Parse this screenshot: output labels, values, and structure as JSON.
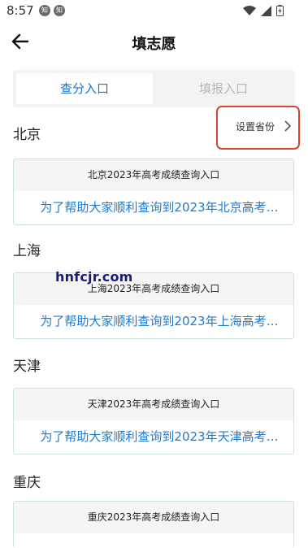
{
  "status_bar": {
    "time": "8:57",
    "notif_1": "知",
    "notif_2": "知"
  },
  "nav": {
    "title": "填志愿"
  },
  "tabs": [
    {
      "label": "查分入口"
    },
    {
      "label": "填报入口"
    }
  ],
  "set_province": {
    "label": "设置省份"
  },
  "provinces": [
    {
      "name": "北京",
      "card_title": "北京2023年高考成绩查询入口",
      "card_link": "为了帮助大家顺利查询到2023年北京高考…"
    },
    {
      "name": "上海",
      "card_title": "上海2023年高考成绩查询入口",
      "card_link": "为了帮助大家顺利查询到2023年上海高考…"
    },
    {
      "name": "天津",
      "card_title": "天津2023年高考成绩查询入口",
      "card_link": "为了帮助大家顺利查询到2023年天津高考…"
    },
    {
      "name": "重庆",
      "card_title": "重庆2023年高考成绩查询入口"
    }
  ],
  "watermark": "hnfcjr.com",
  "colors": {
    "accent": "#1e73c8",
    "highlight_border": "#d9432f",
    "card_border": "#cfe3de"
  }
}
